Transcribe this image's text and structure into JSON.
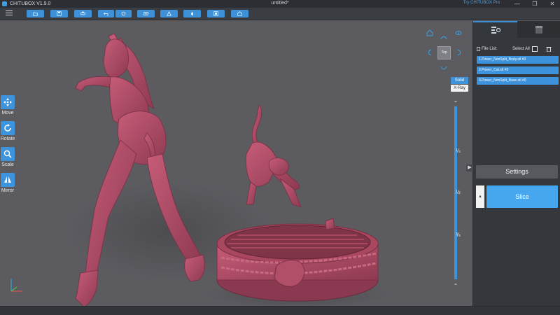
{
  "titlebar": {
    "app_name": "CHITUBOX V1.9.0",
    "doc_title": "untitled*",
    "pro_link": "Try CHITUBOX Pro",
    "minimize": "—",
    "maximize": "❐",
    "close": "✕"
  },
  "toolbar": {
    "icons": [
      "open-file-icon",
      "save-icon",
      "print-icon",
      "undo-icon",
      "redo-icon",
      "screenshot-icon",
      "hollow-icon",
      "drill-icon",
      "repair-icon",
      "settings-icon"
    ]
  },
  "tools": [
    {
      "label": "Move",
      "icon": "move-icon"
    },
    {
      "label": "Rotate",
      "icon": "rotate-icon"
    },
    {
      "label": "Scale",
      "icon": "scale-icon"
    },
    {
      "label": "Mirror",
      "icon": "mirror-icon"
    }
  ],
  "view_cube": {
    "label": "Top"
  },
  "render_modes": {
    "solid": "Solid",
    "xray": "X-Ray"
  },
  "slider": {
    "top_arrow": "⌄",
    "bottom_arrow": "⌃",
    "marks": [
      "¼",
      "½",
      "¾"
    ]
  },
  "panel": {
    "file_list_label": "File List:",
    "select_all": "Select All",
    "files": [
      "1.Power_NonSplit_Body.stl #0",
      "2.Power_Cat.stl #0",
      "3.Power_NonSplit_Base.stl #0"
    ],
    "settings_label": "Settings",
    "slice_label": "Slice",
    "slice_side": "▲",
    "collapse": "▶"
  },
  "colors": {
    "accent": "#3d94dd",
    "model": "#b5506a",
    "viewport": "#5b5b60"
  }
}
